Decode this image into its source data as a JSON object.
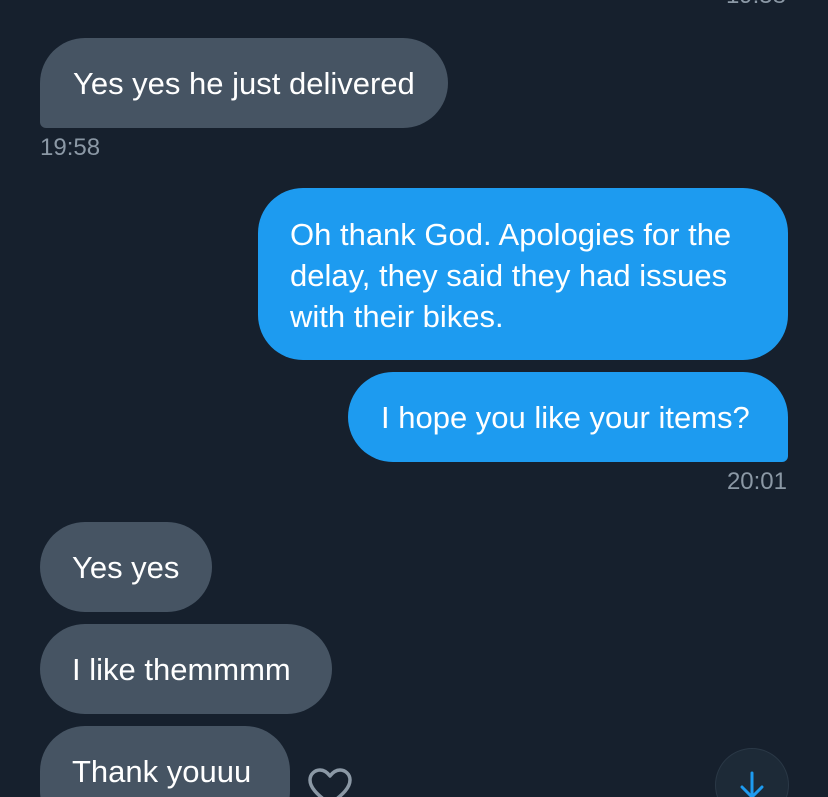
{
  "conversation": {
    "top_timestamp_partial": "19:58",
    "messages": [
      {
        "id": "m1",
        "direction": "received",
        "text": "Yes yes he just delivered"
      },
      {
        "id": "m2",
        "direction": "sent",
        "lines": [
          "Oh thank God. Apologies for the",
          "delay, they said they had issues",
          "with their bikes."
        ]
      },
      {
        "id": "m3",
        "direction": "sent",
        "text": "I hope you like your items?"
      },
      {
        "id": "m4",
        "direction": "received",
        "text": "Yes yes"
      },
      {
        "id": "m5",
        "direction": "received",
        "text": "I like themmmm"
      },
      {
        "id": "m6",
        "direction": "received",
        "text": "Thank youuu"
      }
    ],
    "timestamps": {
      "after_m1": "19:58",
      "after_m3": "20:01"
    }
  },
  "icons": {
    "react": "heart-outline-icon",
    "scroll_down": "arrow-down-icon"
  },
  "colors": {
    "background": "#16202d",
    "received_bubble": "#465463",
    "sent_bubble": "#1d9bf0",
    "timestamp": "#8b98a5"
  }
}
